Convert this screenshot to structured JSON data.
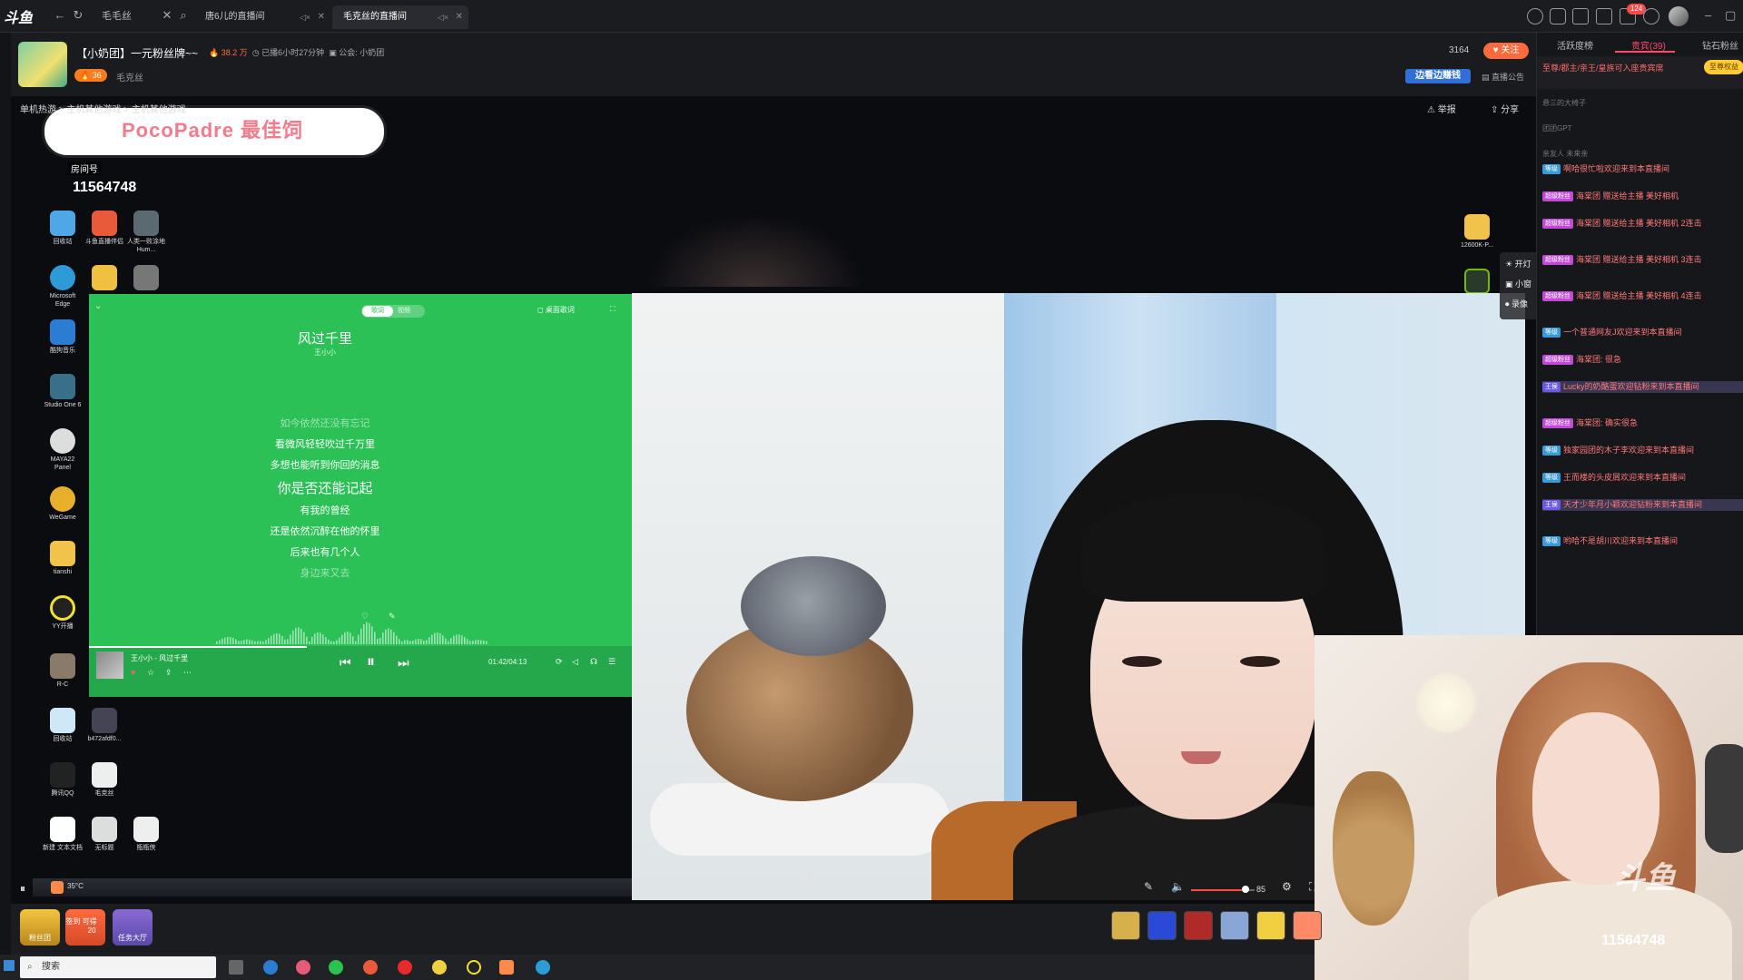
{
  "browser": {
    "logo": "斗鱼",
    "address": "毛毛丝",
    "tabs": [
      {
        "label": "唐6儿的直播间"
      },
      {
        "label": "毛克丝的直播间"
      }
    ],
    "notification_count": "124"
  },
  "room": {
    "title": "【小奶团】一元粉丝牌~~",
    "heat": "38.2 万",
    "uptime": "已播6小时27分钟",
    "announcement": "公会: 小奶团",
    "level": "36",
    "anchor_name": "毛克丝",
    "fans_count": "3164",
    "follow_label": "关注",
    "promo_label": "边看边赚钱",
    "notice_label": "直播公告",
    "breadcrumb": [
      "单机热游",
      "主机其他游戏",
      "主机其他游戏"
    ],
    "report_label": "举报",
    "share_label": "分享"
  },
  "stage": {
    "sticker_text": "PocoPadre  最佳饲",
    "room_label": "房间号",
    "room_number": "11564748",
    "side_panel": [
      "开灯",
      "小窗",
      "录像"
    ],
    "desktop_icons": [
      "回收站",
      "斗鱼直播伴侣",
      "人类一败涂地 Hum...",
      "Microsoft Edge",
      "",
      "",
      "酷狗音乐",
      "Studio One 6",
      "MAYA22 Panel",
      "WeGame",
      "tianshi",
      "YY开播",
      "R-C",
      "回收站",
      "b472afdf0...",
      "腾讯QQ",
      "毛克丝",
      "新建 文本文档",
      "无标题",
      "瓶瓶侠"
    ],
    "right_icons": [
      "12600K-P...",
      ""
    ],
    "temperature": "35°C"
  },
  "player": {
    "mode_on": "歌词",
    "mode_off": "视频",
    "tool_label": "桌面歌词",
    "song_title": "风过千里",
    "artist": "王小小",
    "lyrics": [
      {
        "text": "如今依然还没有忘记",
        "style": "dim"
      },
      {
        "text": "看微风轻轻吹过千万里",
        "style": "normal"
      },
      {
        "text": "多想也能听到你回的消息",
        "style": "normal"
      },
      {
        "text": "你是否还能记起",
        "style": "current"
      },
      {
        "text": "有我的曾经",
        "style": "normal"
      },
      {
        "text": "还是依然沉醉在他的怀里",
        "style": "normal"
      },
      {
        "text": "后来也有几个人",
        "style": "normal"
      },
      {
        "text": "身边来又去",
        "style": "dim"
      }
    ],
    "now_playing": "王小小 - 风过千里",
    "time": "01:42/04:13",
    "progress": 0.4
  },
  "controls": {
    "volume": "85",
    "volume_level": 0.85
  },
  "giftbar": {
    "tools": [
      "粉丝团",
      "签到 可得",
      "任务大厅"
    ],
    "sign_count": "20"
  },
  "taskbar": {
    "search_placeholder": "搜索"
  },
  "chat": {
    "tabs": [
      "活跃度榜",
      "贵宾(39)",
      "钻石粉丝"
    ],
    "rank_text": "至尊/郡主/亲王/皇族可入座贵宾席",
    "rank_button": "至尊权益",
    "dim_lines": [
      "悬三的大椅子",
      "团团GPT",
      "亲友人 未来亲"
    ],
    "messages": [
      {
        "badge": "等级",
        "text": "啊哈很忙啦欢迎来到本直播间"
      },
      {
        "badge": "超级粉丝",
        "text": "海棠团 赠送给主播 美好相机"
      },
      {
        "badge": "超级粉丝",
        "text": "海棠团 赠送给主播 美好相机 2连击"
      },
      {
        "badge": "超级粉丝",
        "text": "海棠团 赠送给主播 美好相机 3连击"
      },
      {
        "badge": "超级粉丝",
        "text": "海棠团 赠送给主播 美好相机 4连击"
      },
      {
        "badge": "等级",
        "text": "一个普通网友J欢迎来到本直播间"
      },
      {
        "badge": "超级粉丝",
        "text": "海棠团: 很急"
      },
      {
        "badge": "王侯",
        "text": "Lucky的奶酪蛋欢迎钻粉来到本直播间",
        "highlight": true
      },
      {
        "badge": "超级粉丝",
        "text": "海棠团: 确实很急"
      },
      {
        "badge": "等级",
        "text": "独家园团的木子李欢迎来到本直播间"
      },
      {
        "badge": "等级",
        "text": "王而楼的头皮屑欢迎来到本直播间"
      },
      {
        "badge": "王侯",
        "text": "天才少年月小颖欢迎钻粉来到本直播间",
        "highlight": true
      },
      {
        "badge": "等级",
        "text": "哟哈不是胡川欢迎来到本直播间"
      }
    ]
  },
  "colors": {
    "accent": "#ff6a3d",
    "player_green": "#2bc157",
    "chat_nick": "#ff7a7a"
  }
}
